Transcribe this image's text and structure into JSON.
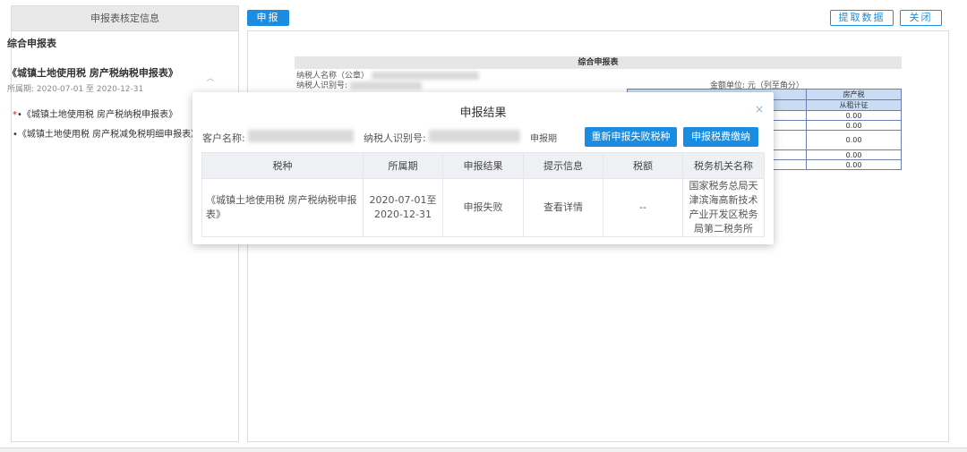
{
  "left": {
    "header": "申报表核定信息",
    "section_title": "综合申报表",
    "form_title": "《城镇土地使用税 房产税纳税申报表》",
    "period": "所属期:  2020-07-01 至 2020-12-31",
    "items": [
      {
        "required": "*",
        "label": "•《城镇土地使用税 房产税纳税申报表》"
      },
      {
        "required": "",
        "label": "•《城镇土地使用税 房产税减免税明细申报表》"
      }
    ]
  },
  "toolbar": {
    "declare_label": "申报",
    "extract_label": "提取数据",
    "close_label": "关闭"
  },
  "report": {
    "title": "综合申报表",
    "taxpayer_name_label": "纳税人名称（公章）",
    "taxpayer_id_label": "纳税人识别号:",
    "unit": "金额单位:  元（列至角分）",
    "header_tax": "房产税",
    "header_col": "从租计征",
    "values": [
      "0.00",
      "0.00",
      "0.00",
      "0.00",
      "0.00"
    ]
  },
  "modal": {
    "title": "申报结果",
    "close_icon": "×",
    "customer_label": "客户名称:",
    "taxid_label": "纳税人识别号:",
    "period_label": "申报期",
    "redeclare_label": "重新申报失败税种",
    "pay_label": "申报税费缴纳",
    "columns": [
      "税种",
      "所属期",
      "申报结果",
      "提示信息",
      "税额",
      "税务机关名称"
    ],
    "rows": [
      {
        "tax_type": "《城镇土地使用税 房产税纳税申报表》",
        "period": "2020-07-01至2020-12-31",
        "result": "申报失败",
        "hint": "查看详情",
        "amount": "--",
        "office": "国家税务总局天津滨海高新技术产业开发区税务局第二税务所"
      }
    ]
  }
}
